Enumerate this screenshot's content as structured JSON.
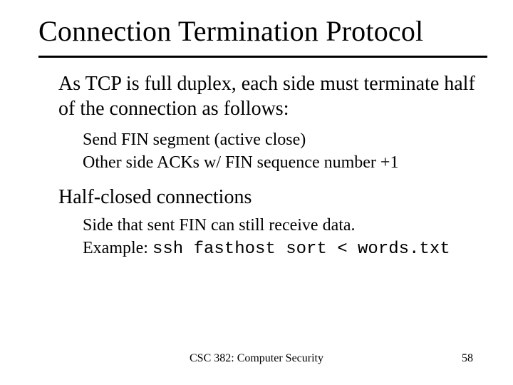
{
  "title": "Connection Termination Protocol",
  "intro": "As TCP is full duplex, each side must terminate half of the connection as follows:",
  "steps": {
    "a": "Send FIN segment (active close)",
    "b": "Other side ACKs w/ FIN sequence number +1"
  },
  "section2_heading": "Half-closed connections",
  "section2": {
    "line1": "Side that sent FIN can still receive data.",
    "example_label": "Example: ",
    "example_cmd": "ssh fasthost sort < words.txt"
  },
  "footer": {
    "course": "CSC 382: Computer Security",
    "page": "58"
  }
}
